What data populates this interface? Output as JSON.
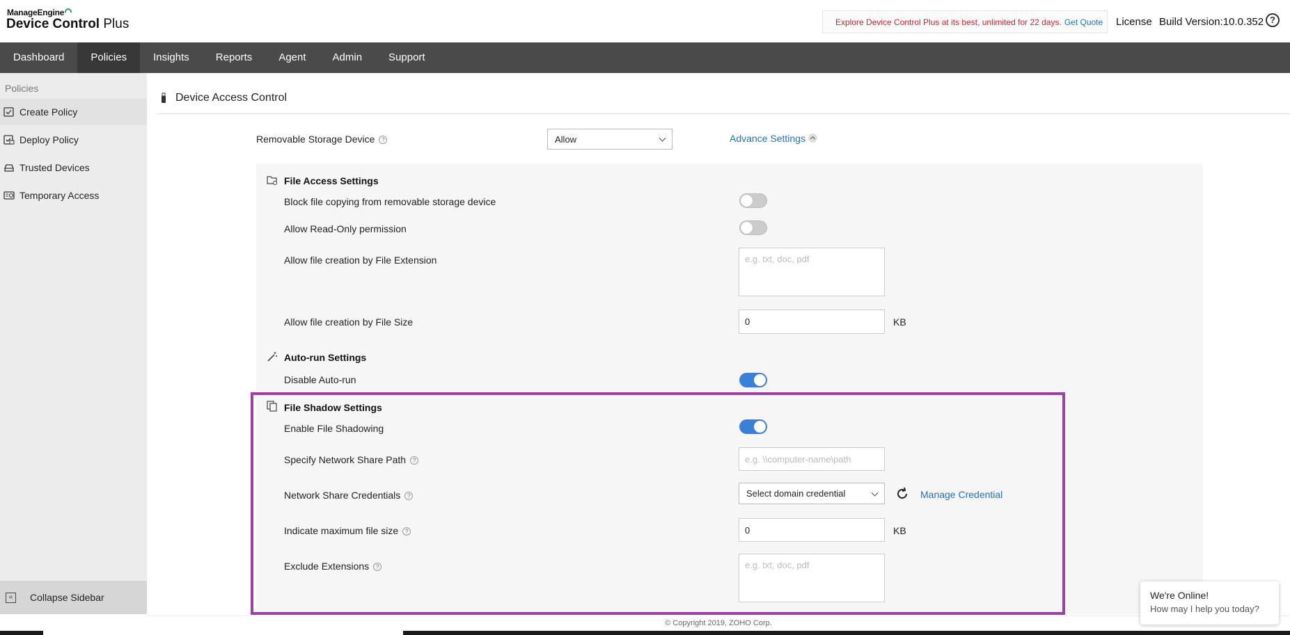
{
  "header": {
    "brand_top": "ManageEngine",
    "brand_main_bold": "Device Control",
    "brand_main_rest": " Plus",
    "trial_text": "Explore Device Control Plus at its best, unlimited for 22 days.",
    "trial_link": "Get Quote",
    "license": "License",
    "build_version": "Build Version:10.0.352",
    "help": "?"
  },
  "topnav": {
    "tabs": [
      {
        "label": "Dashboard"
      },
      {
        "label": "Policies"
      },
      {
        "label": "Insights"
      },
      {
        "label": "Reports"
      },
      {
        "label": "Agent"
      },
      {
        "label": "Admin"
      },
      {
        "label": "Support"
      }
    ],
    "active": "Policies"
  },
  "sidebar": {
    "heading": "Policies",
    "items": [
      {
        "label": "Create Policy"
      },
      {
        "label": "Deploy Policy"
      },
      {
        "label": "Trusted Devices"
      },
      {
        "label": "Temporary Access"
      }
    ],
    "collapse": "Collapse Sidebar"
  },
  "main": {
    "title": "Device Access Control",
    "removable_label": "Removable Storage Device",
    "removable_value": "Allow",
    "advance_settings": "Advance Settings",
    "file_access": {
      "title": "File Access Settings",
      "block_copy": "Block file copying from removable storage device",
      "read_only": "Allow Read-Only permission",
      "ext_label": "Allow file creation by File Extension",
      "ext_placeholder": "e.g. txt, doc, pdf",
      "size_label": "Allow file creation by File Size",
      "size_value": "0",
      "size_unit": "KB"
    },
    "autorun": {
      "title": "Auto-run Settings",
      "disable_label": "Disable Auto-run"
    },
    "shadow": {
      "title": "File Shadow Settings",
      "enable_label": "Enable File Shadowing",
      "path_label": "Specify Network Share Path",
      "path_placeholder": "e.g. \\\\computer-name\\path",
      "cred_label": "Network Share Credentials",
      "cred_value": "Select domain credential",
      "manage_cred": "Manage Credential",
      "max_label": "Indicate maximum file size",
      "max_value": "0",
      "max_unit": "KB",
      "exclude_label": "Exclude Extensions",
      "exclude_placeholder": "e.g. txt, doc, pdf"
    },
    "toggles": {
      "block_copy": false,
      "read_only": false,
      "disable_autorun": true,
      "enable_shadow": true
    }
  },
  "footer": {
    "copyright": "© Copyright 2019, ZOHO Corp."
  },
  "chat": {
    "title": "We're Online!",
    "subtitle": "How may I help you today?"
  },
  "colors": {
    "accent": "#3a7fd8",
    "link": "#1a73c7",
    "highlight": "#9d3fa6",
    "nav_bg": "#4a4a4a",
    "trial_text": "#d2222d"
  }
}
